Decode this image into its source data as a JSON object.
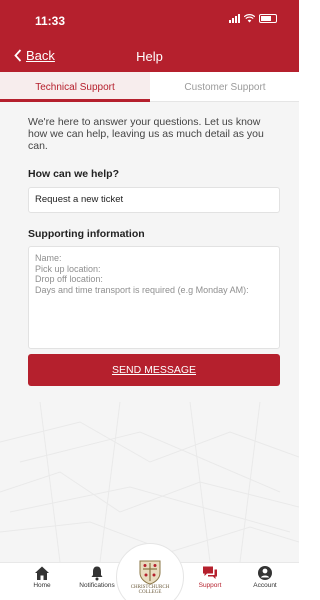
{
  "status_bar": {
    "time": "11:33"
  },
  "nav": {
    "back_label": "Back",
    "title": "Help"
  },
  "tabs": [
    {
      "label": "Technical Support",
      "active": true
    },
    {
      "label": "Customer Support",
      "active": false
    }
  ],
  "intro": "We're here to answer your questions. Let us know how we can help, leaving us as much detail as you can.",
  "form": {
    "help_label": "How can we help?",
    "help_value": "Request a new ticket",
    "info_label": "Supporting information",
    "info_placeholder_lines": [
      "Name:",
      "Pick up location:",
      "Drop off location:",
      "Days and time transport is required (e.g Monday AM):"
    ],
    "send_label": "SEND MESSAGE"
  },
  "bottom_nav": {
    "items": [
      {
        "label": "Home",
        "icon": "home-icon"
      },
      {
        "label": "Notifications",
        "icon": "bell-icon"
      },
      {
        "label": "Support",
        "icon": "chat-icon",
        "active": true
      },
      {
        "label": "Account",
        "icon": "user-icon"
      }
    ],
    "logo_text": "CHRISTCHURCH COLLEGE"
  },
  "colors": {
    "brand": "#b5202d",
    "background": "#f5f5f5"
  }
}
